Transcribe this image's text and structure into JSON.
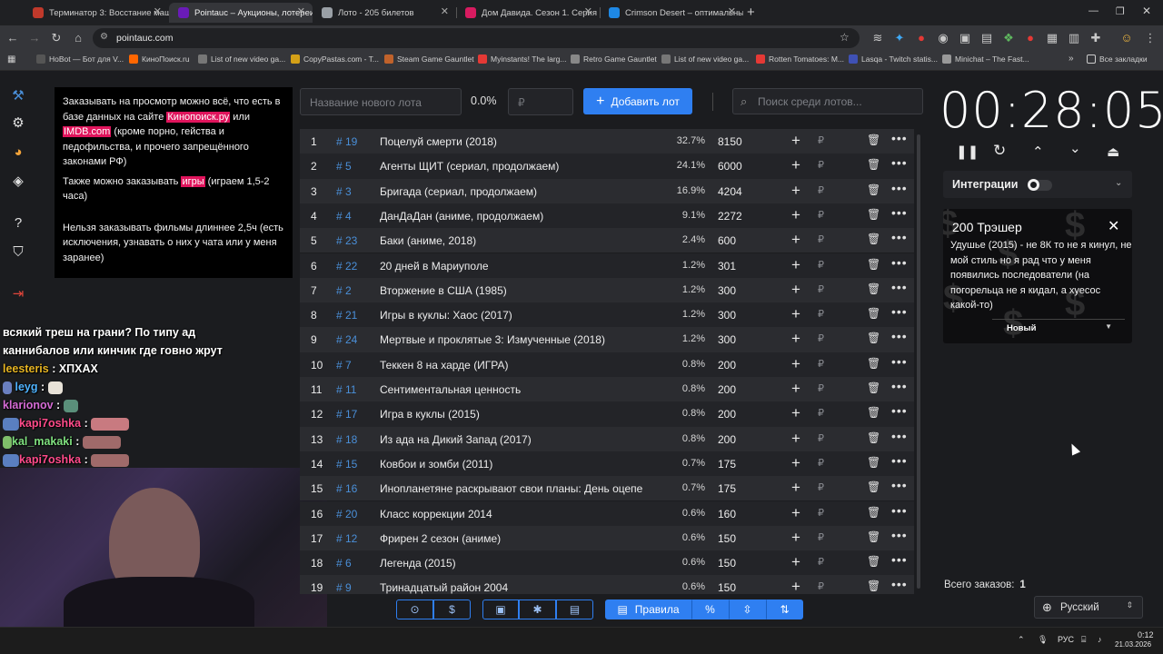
{
  "browser": {
    "tabs": [
      {
        "title": "Терминатор 3: Восстание маш",
        "fav": "#c0392b"
      },
      {
        "title": "Pointauc – Аукционы, лотереи",
        "fav": "#6a1bb8"
      },
      {
        "title": "Лото - 205 билетов",
        "fav": "#9aa0a6"
      },
      {
        "title": "Дом Давида. Сезон 1. Серия 8",
        "fav": "#d81b60"
      },
      {
        "title": "Crimson Desert – оптимальные",
        "fav": "#1e88e5"
      }
    ],
    "url": "pointauc.com",
    "bookmarks": [
      {
        "label": "HoBot — Бот для V...",
        "c": "#555"
      },
      {
        "label": "КиноПоиск.ru",
        "c": "#ff6600"
      },
      {
        "label": "List of new video gа...",
        "c": "#777"
      },
      {
        "label": "CopyPastas.com - T...",
        "c": "#d4a017"
      },
      {
        "label": "Steam Game Gauntlet",
        "c": "#c0622b"
      },
      {
        "label": "Myinstants! The larg...",
        "c": "#e53935"
      },
      {
        "label": "Retro Game Gauntlet",
        "c": "#888"
      },
      {
        "label": "List of new video gа...",
        "c": "#777"
      },
      {
        "label": "Rotten Tomatoes: M...",
        "c": "#e53935"
      },
      {
        "label": "Lasqa - Twitch statis...",
        "c": "#3f51b5"
      },
      {
        "label": "Minichat – The Fast...",
        "c": "#999"
      }
    ],
    "all_bookmarks": "Все закладки"
  },
  "info": {
    "p1_a": "Заказывать на просмотр можно всё, что есть в базе данных на сайте ",
    "p1_link1": "Кинопоиск.ру",
    "p1_b": " или ",
    "p1_link2": "IMDB.com",
    "p1_c": " (кроме порно, гейства и педофильства, и прочего запрещённого законами РФ)",
    "p2_a": "Также можно заказывать ",
    "p2_link": "игры",
    "p2_b": " (играем 1,5-2 часа)",
    "p3": "Нельзя заказывать фильмы длиннее 2,5ч (есть исключения, узнавать о них у чата или у меня заранее)"
  },
  "chat": {
    "line1": "всякий треш на грани? По типу ад",
    "line2": "каннибалов или кинчик где говно жрут",
    "messages": [
      {
        "nick": "leesteris",
        "color": "#e6b422",
        "text": "ХПХАХ"
      },
      {
        "nick": "leyg",
        "color": "#4fb3ff",
        "text": ""
      },
      {
        "nick": "klarionov",
        "color": "#d56bd5",
        "text": ""
      },
      {
        "nick": "kapi7oshka",
        "color": "#ff4b8a",
        "text": ""
      },
      {
        "nick": "kal_makaki",
        "color": "#7fe07f",
        "text": ""
      },
      {
        "nick": "kapi7oshka",
        "color": "#ff4b8a",
        "text": ""
      }
    ]
  },
  "toolbar": {
    "lot_placeholder": "Название нового лота",
    "percent": "0.0%",
    "price_placeholder": "₽",
    "add_label": "Добавить лот",
    "search_placeholder": "Поиск среди лотов..."
  },
  "lots": [
    {
      "rank": "1",
      "id": "# 19",
      "name": "Поцелуй смерти (2018)",
      "pct": "32.7%",
      "amount": "8150"
    },
    {
      "rank": "2",
      "id": "# 5",
      "name": "Агенты ЩИТ (сериал, продолжаем)",
      "pct": "24.1%",
      "amount": "6000"
    },
    {
      "rank": "3",
      "id": "# 3",
      "name": "Бригада (сериал, продолжаем)",
      "pct": "16.9%",
      "amount": "4204"
    },
    {
      "rank": "4",
      "id": "# 4",
      "name": "ДанДаДан (аниме, продолжаем)",
      "pct": "9.1%",
      "amount": "2272"
    },
    {
      "rank": "5",
      "id": "# 23",
      "name": "Баки (аниме, 2018)",
      "pct": "2.4%",
      "amount": "600"
    },
    {
      "rank": "6",
      "id": "# 22",
      "name": "20 дней в Мариуполе",
      "pct": "1.2%",
      "amount": "301"
    },
    {
      "rank": "7",
      "id": "# 2",
      "name": "Вторжение в США (1985)",
      "pct": "1.2%",
      "amount": "300"
    },
    {
      "rank": "8",
      "id": "# 21",
      "name": "Игры в куклы: Хаос (2017)",
      "pct": "1.2%",
      "amount": "300"
    },
    {
      "rank": "9",
      "id": "# 24",
      "name": "Мертвые и проклятые 3: Измученные (2018)",
      "pct": "1.2%",
      "amount": "300"
    },
    {
      "rank": "10",
      "id": "# 7",
      "name": "Теккен 8 на харде (ИГРА)",
      "pct": "0.8%",
      "amount": "200"
    },
    {
      "rank": "11",
      "id": "# 11",
      "name": "Сентиментальная ценность",
      "pct": "0.8%",
      "amount": "200"
    },
    {
      "rank": "12",
      "id": "# 17",
      "name": "Игра в куклы (2015)",
      "pct": "0.8%",
      "amount": "200"
    },
    {
      "rank": "13",
      "id": "# 18",
      "name": "Из ада на Дикий Запад (2017)",
      "pct": "0.8%",
      "amount": "200"
    },
    {
      "rank": "14",
      "id": "# 15",
      "name": "Ковбои и зомби (2011)",
      "pct": "0.7%",
      "amount": "175"
    },
    {
      "rank": "15",
      "id": "# 16",
      "name": "Инопланетяне раскрывают свои планы: День оцепе",
      "pct": "0.7%",
      "amount": "175"
    },
    {
      "rank": "16",
      "id": "# 20",
      "name": "Класс коррекции 2014",
      "pct": "0.6%",
      "amount": "160"
    },
    {
      "rank": "17",
      "id": "# 12",
      "name": "Фрирен 2 сезон (аниме)",
      "pct": "0.6%",
      "amount": "150"
    },
    {
      "rank": "18",
      "id": "# 6",
      "name": "Легенда (2015)",
      "pct": "0.6%",
      "amount": "150"
    },
    {
      "rank": "19",
      "id": "# 9",
      "name": "Тринадцатый район 2004",
      "pct": "0.6%",
      "amount": "150"
    }
  ],
  "lot_row_icons": {
    "plus": "+",
    "rub": "₽",
    "delete": "🗑",
    "more": "•••"
  },
  "bottom": {
    "rules_label": "Правила"
  },
  "timer": {
    "time": "00:28:05"
  },
  "integrations": {
    "label": "Интеграции"
  },
  "card": {
    "title": "200 Трэшер",
    "text": "Удушье (2015) - не 8К то не я кинул, не мой стиль но я рад что у меня появились последователи (на погорельца не я кидал, а хуесос какой-то)",
    "select": "Новый"
  },
  "footer": {
    "orders_label": "Всего заказов:",
    "orders_count": "1",
    "language": "Русский"
  },
  "taskbar": {
    "lang": "РУС",
    "time": "0:12",
    "date": "21.03.2026"
  }
}
